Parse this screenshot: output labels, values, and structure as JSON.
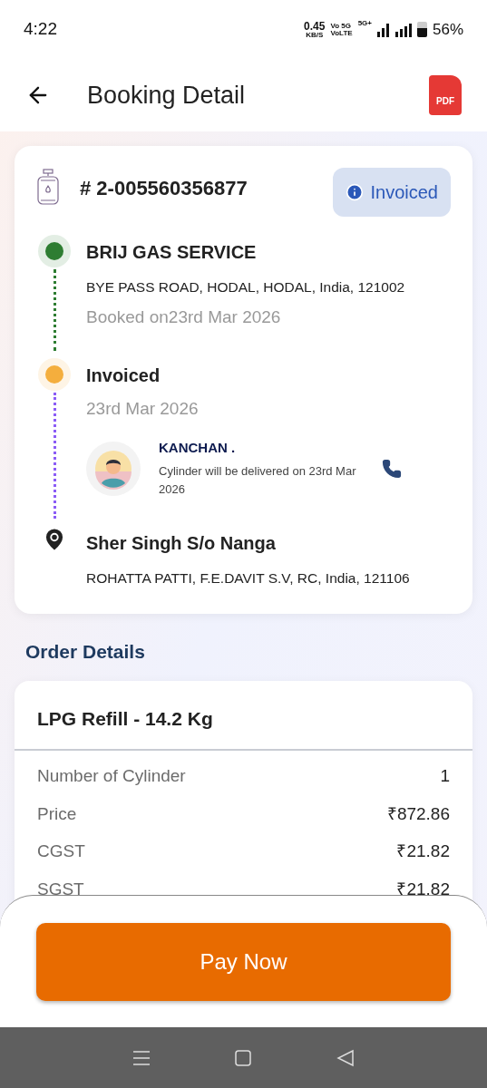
{
  "status_bar": {
    "time": "4:22",
    "speed": "0.45",
    "speed_unit": "KB/S",
    "volte_top": "Vo 5G",
    "volte_bottom": "VoLTE",
    "network": "5G+",
    "battery": "56%"
  },
  "header": {
    "title": "Booking Detail",
    "pdf_label": "PDF"
  },
  "booking": {
    "number": "# 2-005560356877",
    "status": "Invoiced",
    "timeline": [
      {
        "kind": "dot",
        "color": "#2e7d32",
        "title": "BRIJ GAS SERVICE",
        "address": "BYE PASS ROAD, HODAL, HODAL, India, 121002",
        "date": "Booked on23rd Mar 2026"
      },
      {
        "kind": "dot",
        "color": "#f4ae3d",
        "title": "Invoiced",
        "date": "23rd Mar 2026",
        "agent": {
          "name": "KANCHAN .",
          "message": "Cylinder will be delivered on 23rd Mar 2026"
        }
      },
      {
        "kind": "pin",
        "title": "Sher Singh S/o Nanga",
        "address": "ROHATTA PATTI, F.E.DAVIT S.V,  RC, India, 121106"
      }
    ]
  },
  "order_details": {
    "heading": "Order Details",
    "product": "LPG Refill - 14.2 Kg",
    "rows": [
      {
        "label": "Number of Cylinder",
        "value": "1"
      },
      {
        "label": "Price",
        "value": "₹872.86"
      },
      {
        "label": "CGST",
        "value": "₹21.82"
      },
      {
        "label": "SGST",
        "value": "₹21.82"
      }
    ]
  },
  "pay_button": "Pay Now"
}
